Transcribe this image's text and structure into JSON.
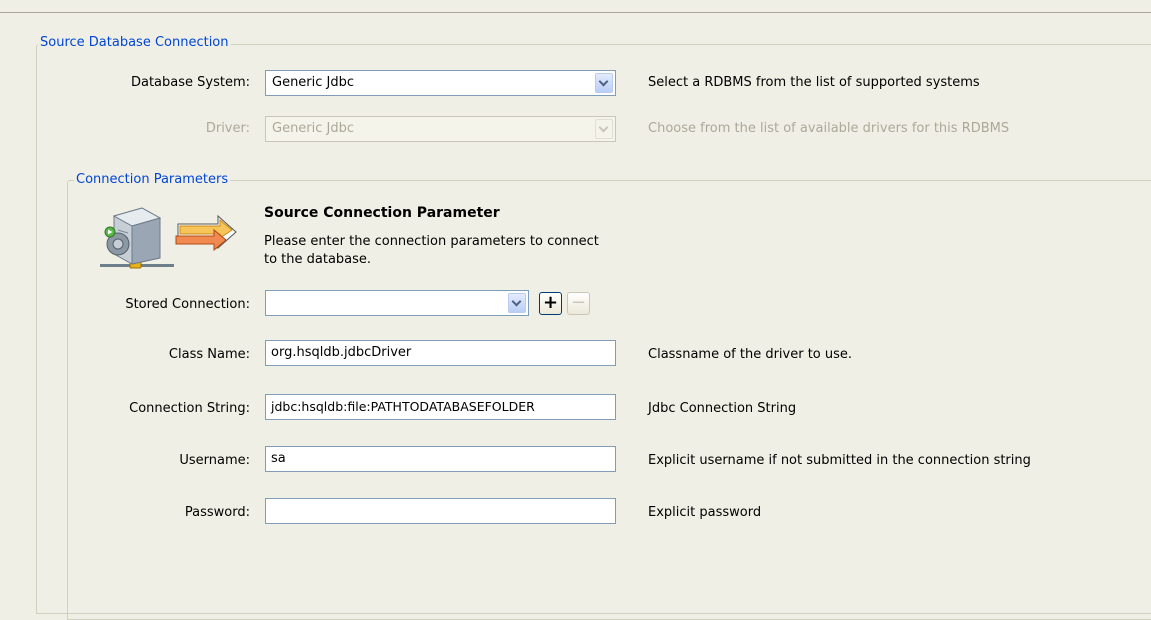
{
  "source_group": {
    "legend": "Source Database Connection",
    "database_system": {
      "label": "Database System:",
      "value": "Generic Jdbc",
      "help": "Select a RDBMS from the list of supported systems"
    },
    "driver": {
      "label": "Driver:",
      "value": "Generic Jdbc",
      "help": "Choose from the list of available drivers for this RDBMS"
    }
  },
  "params_group": {
    "legend": "Connection Parameters",
    "header": {
      "title": "Source Connection Parameter",
      "description": "Please enter the connection parameters to connect to the database."
    },
    "stored_connection": {
      "label": "Stored Connection:",
      "value": "",
      "add_button": "+",
      "remove_button": "−"
    },
    "class_name": {
      "label": "Class Name:",
      "value": "org.hsqldb.jdbcDriver",
      "help": "Classname of the driver to use."
    },
    "connection_string": {
      "label": "Connection String:",
      "value": "jdbc:hsqldb:file:PATHTODATABASEFOLDER",
      "help": "Jdbc Connection String"
    },
    "username": {
      "label": "Username:",
      "value": "sa",
      "help": "Explicit username if not submitted in the connection string"
    },
    "password": {
      "label": "Password:",
      "value": "",
      "help": "Explicit password"
    }
  },
  "colors": {
    "legend_text": "#0046d5",
    "background": "#f0efe6",
    "disabled_text": "#aca899",
    "field_border": "#7f9db9"
  },
  "icons": {
    "server": "server-connection-icon",
    "arrows": "arrows-right-icon",
    "dropdown": "chevron-down-icon"
  }
}
